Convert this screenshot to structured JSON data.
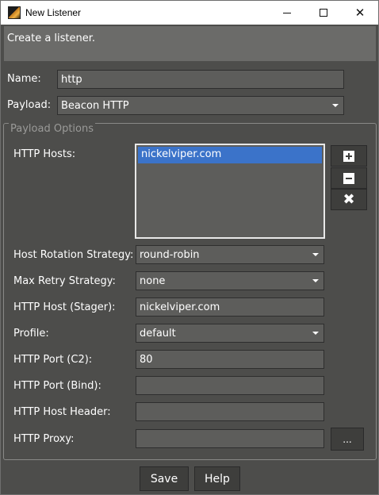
{
  "window": {
    "title": "New Listener",
    "controls": {
      "minimize": "minimize",
      "maximize": "maximize",
      "close": "close"
    }
  },
  "banner": {
    "text": "Create a listener."
  },
  "form": {
    "name": {
      "label": "Name:",
      "value": "http"
    },
    "payload": {
      "label": "Payload:",
      "value": "Beacon HTTP"
    }
  },
  "payload_options": {
    "title": "Payload Options",
    "http_hosts": {
      "label": "HTTP Hosts:",
      "items": [
        "nickelviper.com"
      ]
    },
    "host_buttons": {
      "add": "add-host",
      "remove": "remove-host",
      "clear": "clear-hosts"
    },
    "host_rotation": {
      "label": "Host Rotation Strategy:",
      "value": "round-robin"
    },
    "max_retry": {
      "label": "Max Retry Strategy:",
      "value": "none"
    },
    "http_host_stager": {
      "label": "HTTP Host (Stager):",
      "value": "nickelviper.com"
    },
    "profile": {
      "label": "Profile:",
      "value": "default"
    },
    "http_port_c2": {
      "label": "HTTP Port (C2):",
      "value": "80"
    },
    "http_port_bind": {
      "label": "HTTP Port (Bind):",
      "value": ""
    },
    "http_host_header": {
      "label": "HTTP Host Header:",
      "value": ""
    },
    "http_proxy": {
      "label": "HTTP Proxy:",
      "value": "",
      "browse_label": "..."
    }
  },
  "buttons": {
    "save": "Save",
    "help": "Help"
  },
  "colors": {
    "background": "#4d4d4b",
    "field": "#5d5d5b",
    "selection": "#3b73c9",
    "button": "#3e3e3c"
  }
}
